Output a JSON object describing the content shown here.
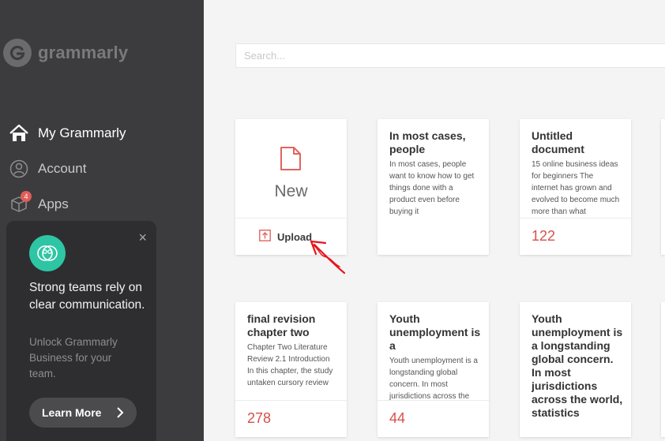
{
  "brand": {
    "name": "grammarly",
    "logo_icon": "grammarly-g-icon"
  },
  "sidebar": {
    "nav": [
      {
        "label": "My Grammarly",
        "icon": "home-icon",
        "active": true
      },
      {
        "label": "Account",
        "icon": "user-icon"
      },
      {
        "label": "Apps",
        "icon": "box-icon",
        "badge": "4"
      }
    ],
    "promo": {
      "icon": "team-icon",
      "title": "Strong teams rely on clear communication.",
      "subtitle": "Unlock Grammarly Business for your team.",
      "button": "Learn More",
      "close": "×"
    }
  },
  "search": {
    "placeholder": "Search..."
  },
  "new_card": {
    "label": "New",
    "upload_label": "Upload"
  },
  "documents": [
    {
      "title": "In most cases, people",
      "preview": "In most cases, people want to know how to get things done with a product even before buying it",
      "count": ""
    },
    {
      "title": "Untitled document",
      "preview": "15 online business ideas for beginners The internet has grown and evolved to become much more than what",
      "count": "122"
    },
    {
      "title": "final revision chapter two",
      "preview": "Chapter Two Literature Review 2.1 Introduction In this chapter, the study untaken cursory review",
      "count": "278"
    },
    {
      "title": "Youth unemployment is a",
      "preview": "Youth unemployment is a longstanding global concern. In most jurisdictions across the",
      "count": "44"
    },
    {
      "title": "Youth unemployment is a longstanding global concern. In most jurisdictions across the world, statistics",
      "preview": "",
      "count": ""
    }
  ],
  "colors": {
    "sidebar": "#3c3c3f",
    "accent": "#d6504a",
    "promo_icon": "#2ec5a4"
  }
}
